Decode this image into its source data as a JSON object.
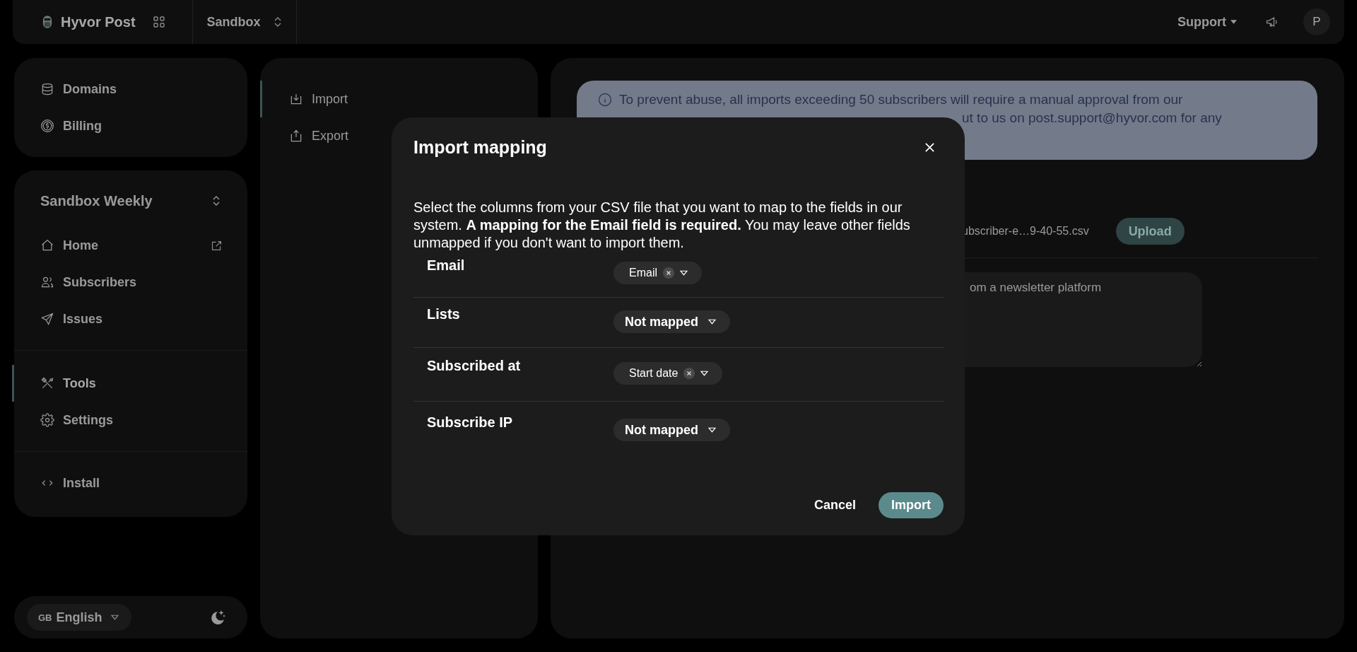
{
  "top_bar": {
    "app_name": "Hyvor Post",
    "project": "Sandbox",
    "support": "Support",
    "avatar": "P"
  },
  "sidebar": {
    "console_items": [
      {
        "label": "Domains"
      },
      {
        "label": "Billing"
      }
    ],
    "newsletter": "Sandbox Weekly",
    "nav_items": [
      {
        "label": "Home",
        "selected": false
      },
      {
        "label": "Subscribers",
        "selected": false
      },
      {
        "label": "Issues",
        "selected": false
      }
    ],
    "tool_items": [
      {
        "label": "Tools",
        "selected": true
      },
      {
        "label": "Settings",
        "selected": false
      }
    ],
    "install": "Install",
    "language_code": "GB",
    "language": "English"
  },
  "tools_nav": [
    {
      "label": "Import",
      "selected": true
    },
    {
      "label": "Export",
      "selected": false
    }
  ],
  "import_panel": {
    "notice_line_1": "To prevent abuse, all imports exceeding 50 subscribers will require a manual approval from our",
    "notice_line_2": "ut to us on post.support@hyvor.com for any",
    "file_name": "ubscriber-e…9-40-55.csv",
    "upload": {
      "label": "Upload",
      "disabled": true
    },
    "source_value": "om a newsletter platform"
  },
  "modal": {
    "title": "Import mapping",
    "description": "Select the columns from your CSV file that you want to map to the fields in our system. **A mapping for the Email field is required.** You may leave other fields unmapped if you don't want to import them.",
    "rows": [
      {
        "field": "Email",
        "mapping": "Email",
        "mapped": true
      },
      {
        "field": "Lists",
        "mapping": "Not mapped",
        "mapped": false
      },
      {
        "field": "Subscribed at",
        "mapping": "Start date",
        "mapped": true
      },
      {
        "field": "Subscribe IP",
        "mapping": "Not mapped",
        "mapped": false
      }
    ],
    "cancel": "Cancel",
    "import": "Import"
  }
}
